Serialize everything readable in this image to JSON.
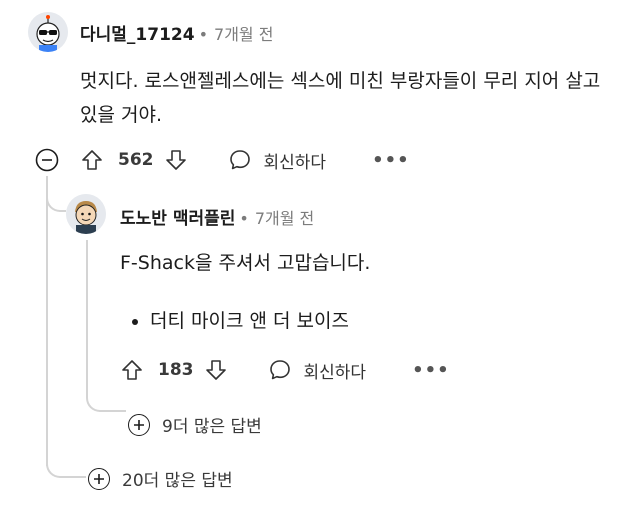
{
  "comment": {
    "username": "다니멀_17124",
    "time": "7개월 전",
    "body": "멋지다. 로스앤젤레스에는 섹스에 미친 부랑자들이 무리 지어 살고 있을 거야.",
    "votes": "562",
    "reply_label": "회신하다",
    "more_label": "•••",
    "avatar_icon": "sunglasses-avatar-icon"
  },
  "reply": {
    "username": "도노반 맥러플린",
    "time": "7개월 전",
    "body": "F-Shack을 주셔서 고맙습니다.",
    "bullets": [
      "더티 마이크 앤 더 보이즈"
    ],
    "votes": "183",
    "reply_label": "회신하다",
    "more_label": "•••",
    "more_replies": "9더 많은 답변",
    "avatar_icon": "cartoon-avatar-icon"
  },
  "thread": {
    "more_replies": "20더 많은 답변"
  },
  "colors": {
    "text": "#1c1c1c",
    "meta": "#7c7c7c",
    "thread_line": "#d4d4d4"
  }
}
